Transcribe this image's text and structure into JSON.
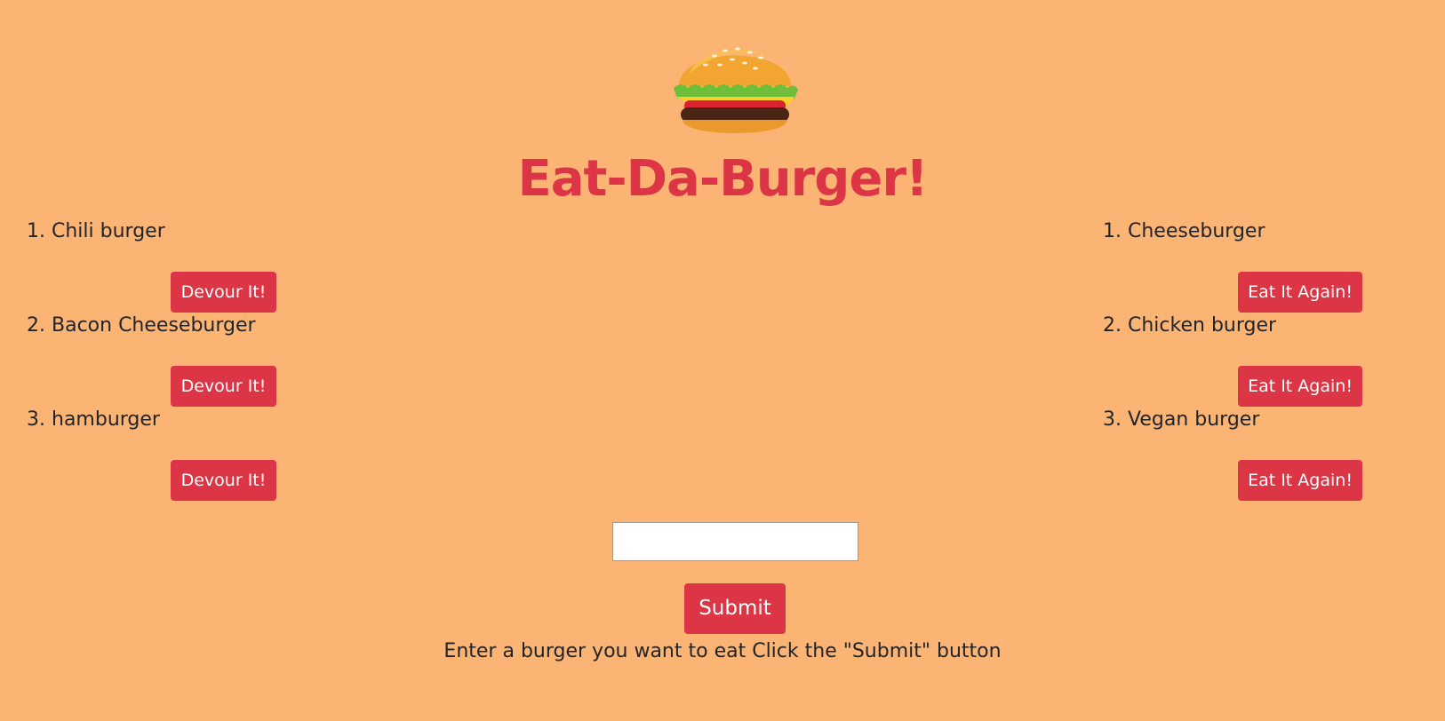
{
  "header": {
    "logo_icon": "hamburger-icon",
    "title": "Eat-Da-Burger!"
  },
  "not_devoured": {
    "items": [
      {
        "number": "1.",
        "name": "Chili burger",
        "button_label": "Devour It!"
      },
      {
        "number": "2.",
        "name": "Bacon Cheeseburger",
        "button_label": "Devour It!"
      },
      {
        "number": "3.",
        "name": "hamburger",
        "button_label": "Devour It!"
      }
    ]
  },
  "devoured": {
    "items": [
      {
        "number": "1.",
        "name": "Cheeseburger",
        "button_label": "Eat It Again!"
      },
      {
        "number": "2.",
        "name": "Chicken burger",
        "button_label": "Eat It Again!"
      },
      {
        "number": "3.",
        "name": "Vegan burger",
        "button_label": "Eat It Again!"
      }
    ]
  },
  "form": {
    "input_value": "",
    "input_placeholder": "",
    "submit_label": "Submit",
    "instructions": "Enter a burger you want to eat Click the \"Submit\" button"
  },
  "colors": {
    "background": "#fbb474",
    "accent": "#dc3545"
  }
}
